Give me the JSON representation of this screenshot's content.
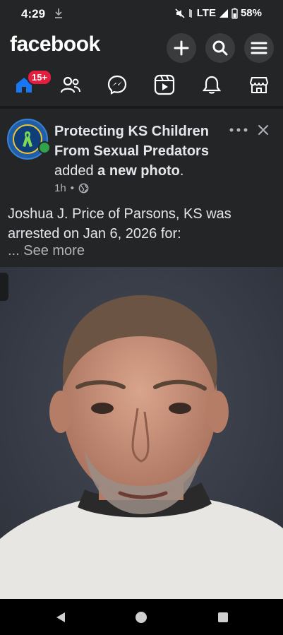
{
  "status": {
    "time": "4:29",
    "network": "LTE",
    "battery": "58%"
  },
  "header": {
    "logo": "facebook",
    "buttons": [
      "plus-icon",
      "search-icon",
      "menu-icon"
    ]
  },
  "nav": {
    "items": [
      {
        "name": "home",
        "badge": "15+"
      },
      {
        "name": "friends"
      },
      {
        "name": "messenger"
      },
      {
        "name": "video"
      },
      {
        "name": "notifications"
      },
      {
        "name": "marketplace"
      }
    ]
  },
  "post": {
    "page_name": "Protecting KS Children From Sexual Predators",
    "action_prefix": "added ",
    "action_object": "a new photo",
    "action_suffix": ".",
    "time": "1h",
    "text": "Joshua J. Price of Parsons, KS was arrested on Jan 6, 2026 for:",
    "see_more_prefix": "... ",
    "see_more": "See more"
  },
  "colors": {
    "background": "#242526",
    "text": "#e4e6eb",
    "secondary_text": "#b0b3b8",
    "badge": "#e41e3f",
    "online": "#31a24c"
  }
}
